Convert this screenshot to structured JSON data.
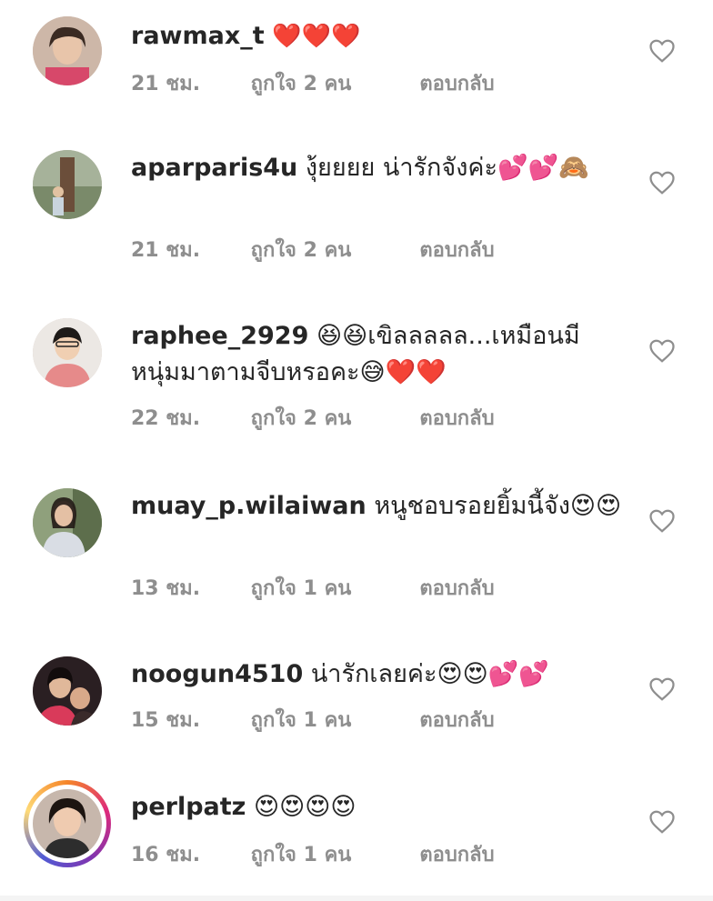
{
  "comments": [
    {
      "username": "rawmax_t",
      "text": "❤️❤️❤️",
      "time": "21 ชม.",
      "likes": "ถูกใจ 2 คน",
      "reply": "ตอบกลับ",
      "like_icon": "heart-outline-icon"
    },
    {
      "username": "aparparis4u",
      "text": "งุ้ยยยย น่ารักจังค่ะ💕💕🙈",
      "time": "21 ชม.",
      "likes": "ถูกใจ 2 คน",
      "reply": "ตอบกลับ",
      "like_icon": "heart-outline-icon"
    },
    {
      "username": "raphee_2929",
      "text": "😆😆เขิลลลลล...เหมือนมีหนุ่มมาตามจีบหรอคะ😅❤️❤️",
      "time": "22 ชม.",
      "likes": "ถูกใจ 2 คน",
      "reply": "ตอบกลับ",
      "like_icon": "heart-outline-icon"
    },
    {
      "username": "muay_p.wilaiwan",
      "text": "หนูชอบรอยยิ้มนี้จัง😍😍",
      "time": "13 ชม.",
      "likes": "ถูกใจ 1 คน",
      "reply": "ตอบกลับ",
      "like_icon": "heart-outline-icon"
    },
    {
      "username": "noogun4510",
      "text": "น่ารักเลยค่ะ😍😍💕💕",
      "time": "15 ชม.",
      "likes": "ถูกใจ 1 คน",
      "reply": "ตอบกลับ",
      "like_icon": "heart-outline-icon"
    },
    {
      "username": "perlpatz",
      "text": "😍😍😍😍",
      "time": "16 ชม.",
      "likes": "ถูกใจ 1 คน",
      "reply": "ตอบกลับ",
      "like_icon": "heart-outline-icon"
    }
  ],
  "colors": {
    "username": "#262626",
    "meta": "#8e8e8e",
    "heart_outline": "#8e8e8e"
  }
}
